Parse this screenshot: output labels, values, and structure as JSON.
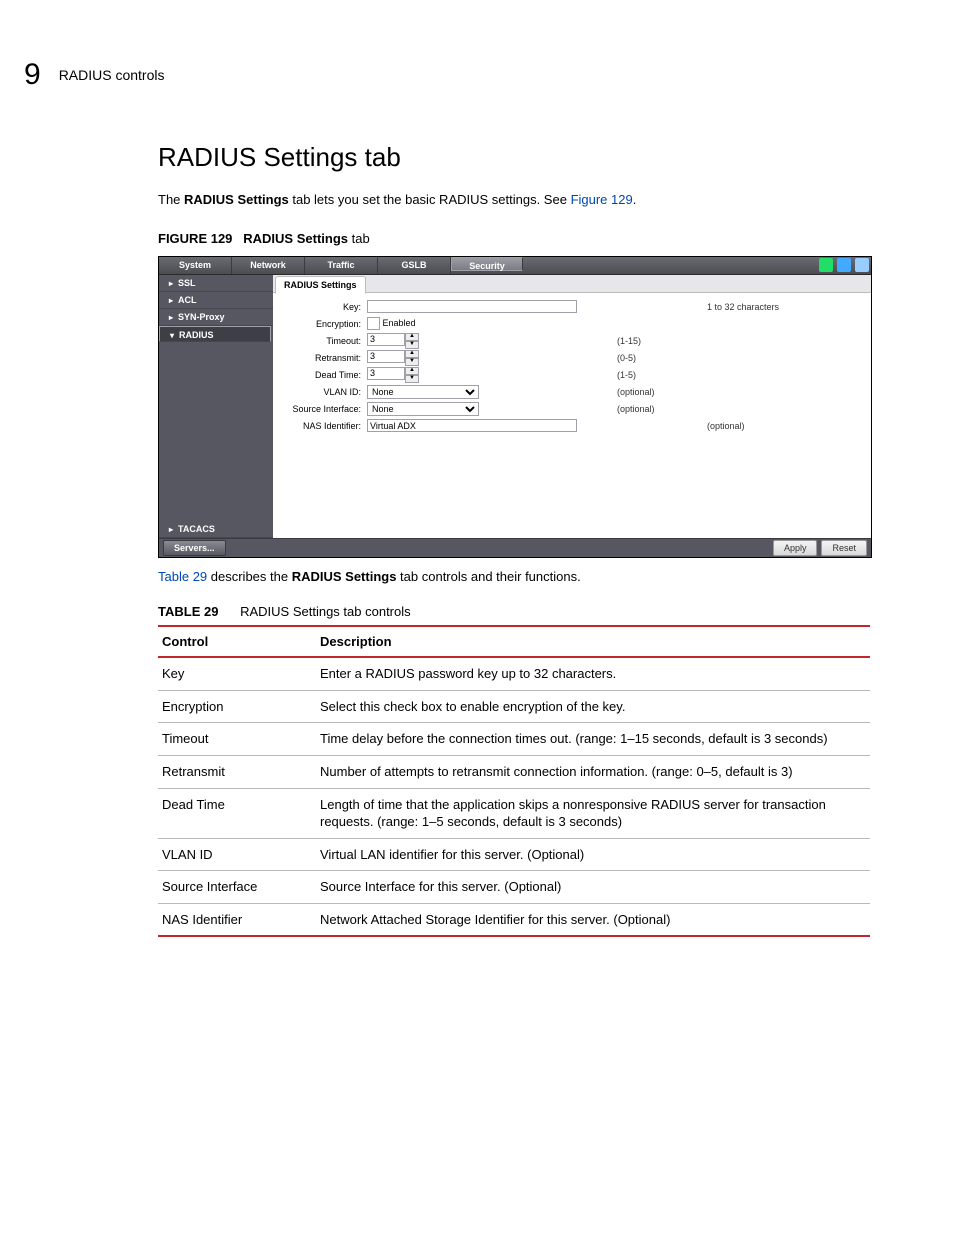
{
  "header": {
    "chapter_number": "9",
    "chapter_title": "RADIUS controls"
  },
  "section": {
    "title": "RADIUS Settings tab",
    "intro_pre": "The ",
    "intro_bold": "RADIUS Settings",
    "intro_mid": " tab lets you set the basic RADIUS settings. See ",
    "intro_link": "Figure 129",
    "intro_post": "."
  },
  "figure": {
    "label": "FIGURE 129",
    "caption_bold": "RADIUS Settings",
    "caption_tail": " tab"
  },
  "screenshot": {
    "topnav": [
      "System",
      "Network",
      "Traffic",
      "GSLB",
      "Security"
    ],
    "topnav_selected": 4,
    "sidenav_top": [
      "SSL",
      "ACL",
      "SYN-Proxy",
      "RADIUS"
    ],
    "sidenav_selected": 3,
    "sidenav_bottom": "TACACS",
    "subtab": "RADIUS Settings",
    "fields": {
      "key": {
        "label": "Key:",
        "value": "",
        "hint": "1 to 32 characters"
      },
      "enc": {
        "label": "Encryption:",
        "value": "Enabled",
        "hint": ""
      },
      "timeout": {
        "label": "Timeout:",
        "value": "3",
        "hint": "(1-15)"
      },
      "retransmit": {
        "label": "Retransmit:",
        "value": "3",
        "hint": "(0-5)"
      },
      "deadtime": {
        "label": "Dead Time:",
        "value": "3",
        "hint": "(1-5)"
      },
      "vlan": {
        "label": "VLAN ID:",
        "value": "None",
        "hint": "(optional)"
      },
      "srcif": {
        "label": "Source Interface:",
        "value": "None",
        "hint": "(optional)"
      },
      "nas": {
        "label": "NAS Identifier:",
        "value": "Virtual ADX",
        "hint": "(optional)"
      }
    },
    "buttons": {
      "servers": "Servers...",
      "apply": "Apply",
      "reset": "Reset"
    }
  },
  "after_figure": {
    "link": "Table 29",
    "mid": " describes the ",
    "bold": "RADIUS Settings",
    "tail": " tab controls and their functions."
  },
  "table": {
    "label": "TABLE 29",
    "caption": "RADIUS Settings tab controls",
    "head": [
      "Control",
      "Description"
    ],
    "rows": [
      [
        "Key",
        "Enter a RADIUS password key up to 32 characters."
      ],
      [
        "Encryption",
        "Select this check box to enable encryption of the key."
      ],
      [
        "Timeout",
        "Time delay before the connection times out. (range: 1–15 seconds, default is 3 seconds)"
      ],
      [
        "Retransmit",
        "Number of attempts to retransmit connection information. (range: 0–5, default is 3)"
      ],
      [
        "Dead Time",
        "Length of time that the application skips a nonresponsive RADIUS server for transaction requests. (range: 1–5 seconds, default is 3 seconds)"
      ],
      [
        "VLAN ID",
        "Virtual LAN identifier for this server. (Optional)"
      ],
      [
        "Source Interface",
        "Source Interface for this server. (Optional)"
      ],
      [
        "NAS Identifier",
        "Network Attached Storage Identifier for this server. (Optional)"
      ]
    ]
  }
}
